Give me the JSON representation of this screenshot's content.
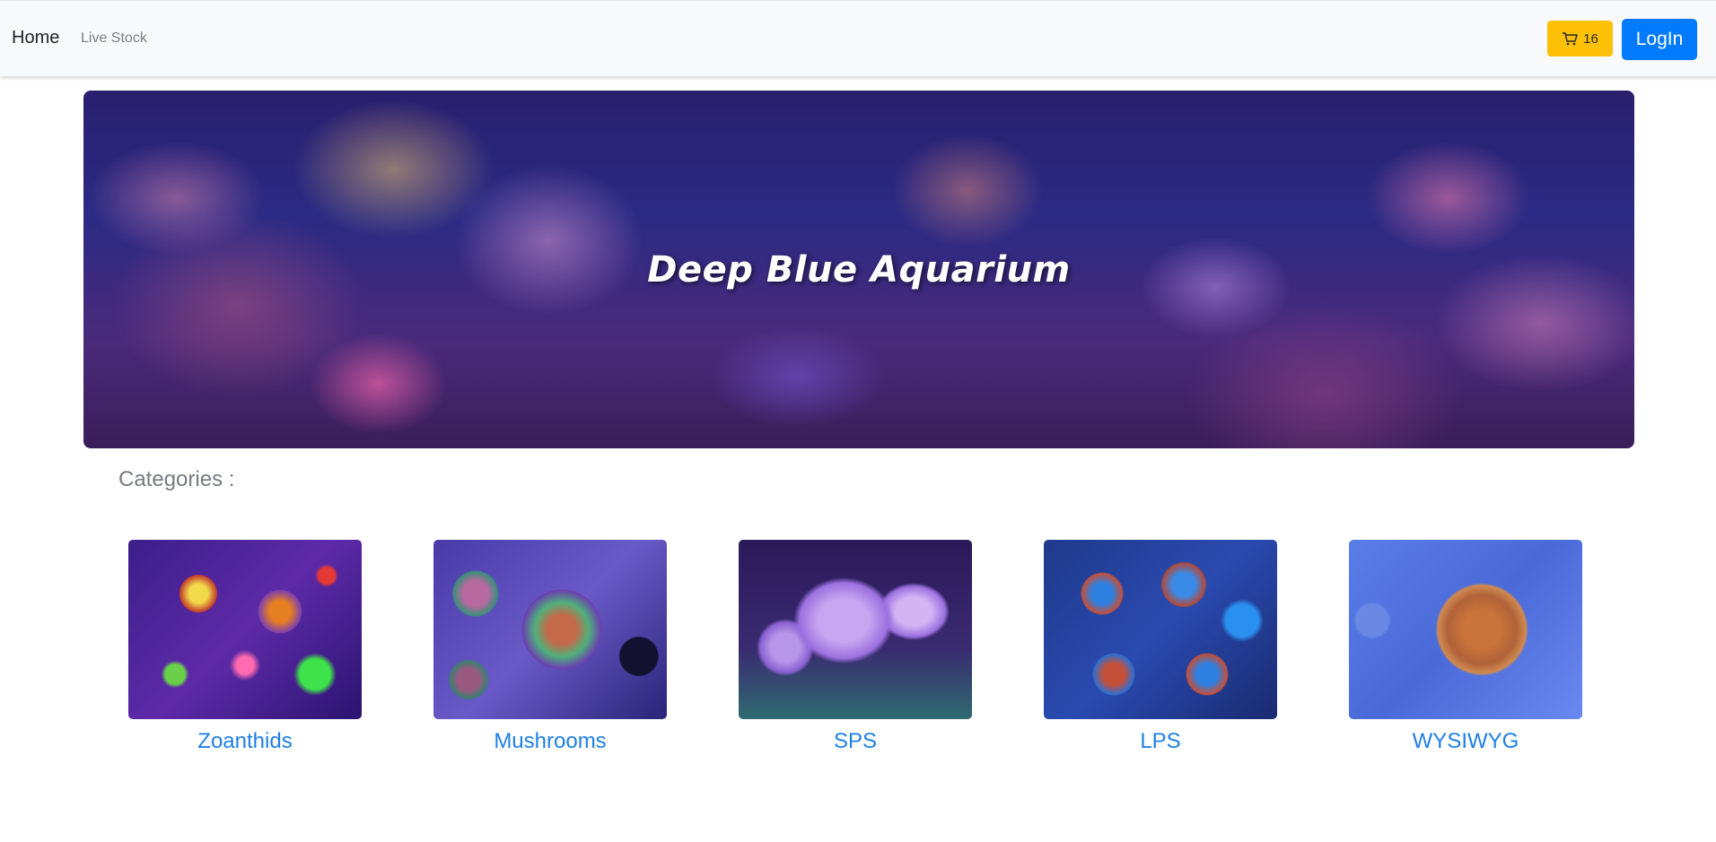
{
  "nav": {
    "home_label": "Home",
    "livestock_label": "Live Stock",
    "cart_count": "16",
    "cart_icon": "cart-icon",
    "login_label": "LogIn"
  },
  "hero": {
    "title": "Deep Blue Aquarium"
  },
  "categories": {
    "heading": "Categories :",
    "items": [
      {
        "label": "Zoanthids"
      },
      {
        "label": "Mushrooms"
      },
      {
        "label": "SPS"
      },
      {
        "label": "LPS"
      },
      {
        "label": "WYSIWYG"
      }
    ]
  },
  "colors": {
    "navbar_bg": "#f8f9fa",
    "cart_button": "#ffc107",
    "login_button": "#007bff",
    "category_link": "#1e7fe6"
  }
}
